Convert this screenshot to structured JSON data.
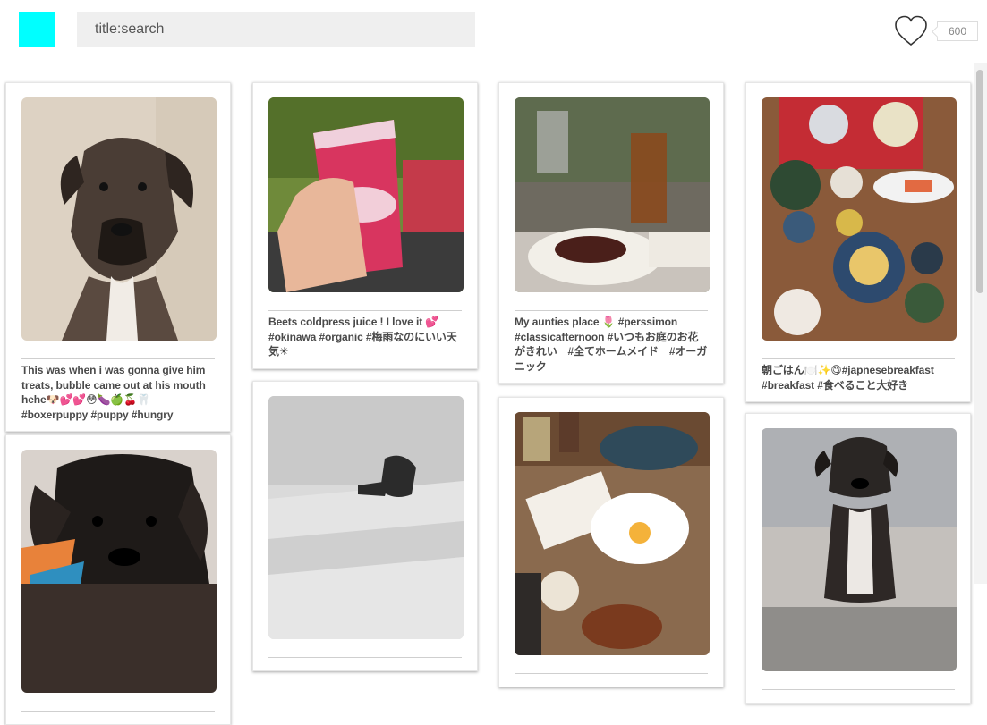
{
  "app": {
    "logo_color": "#00ffff",
    "search": {
      "placeholder": "title:search",
      "value": ""
    },
    "like_count": "600",
    "heart_icon": "heart-outline-icon"
  },
  "posts": [
    {
      "caption": "This was when i was gonna give him treats, bubble came out at his mouth hehe🐶💕💕😳🍆🍏🍒🦷 #boxerpuppy #puppy #hungry",
      "photo": "boxer-puppy-sepia"
    },
    {
      "caption": "",
      "photo": "black-puppy-closeup"
    },
    {
      "caption": "Beets coldpress juice ! I love it 💕 #okinawa #organic #梅雨なのにいい天気☀",
      "photo": "pink-juice-cup"
    },
    {
      "caption": "",
      "photo": "puppy-on-stairs"
    },
    {
      "caption": "My aunties place 🌷 #perssimon #classicafternoon #いつもお庭のお花がきれい　#全てホームメイド　#オーガニック",
      "photo": "iced-tea-and-cake"
    },
    {
      "caption": "",
      "photo": "breakfast-table"
    },
    {
      "caption": "朝ごはん🍽️✨😋#japnesebreakfast #breakfast #食べること大好き",
      "photo": "japanese-breakfast-tray"
    },
    {
      "caption": "",
      "photo": "boxer-puppy-sitting"
    }
  ]
}
